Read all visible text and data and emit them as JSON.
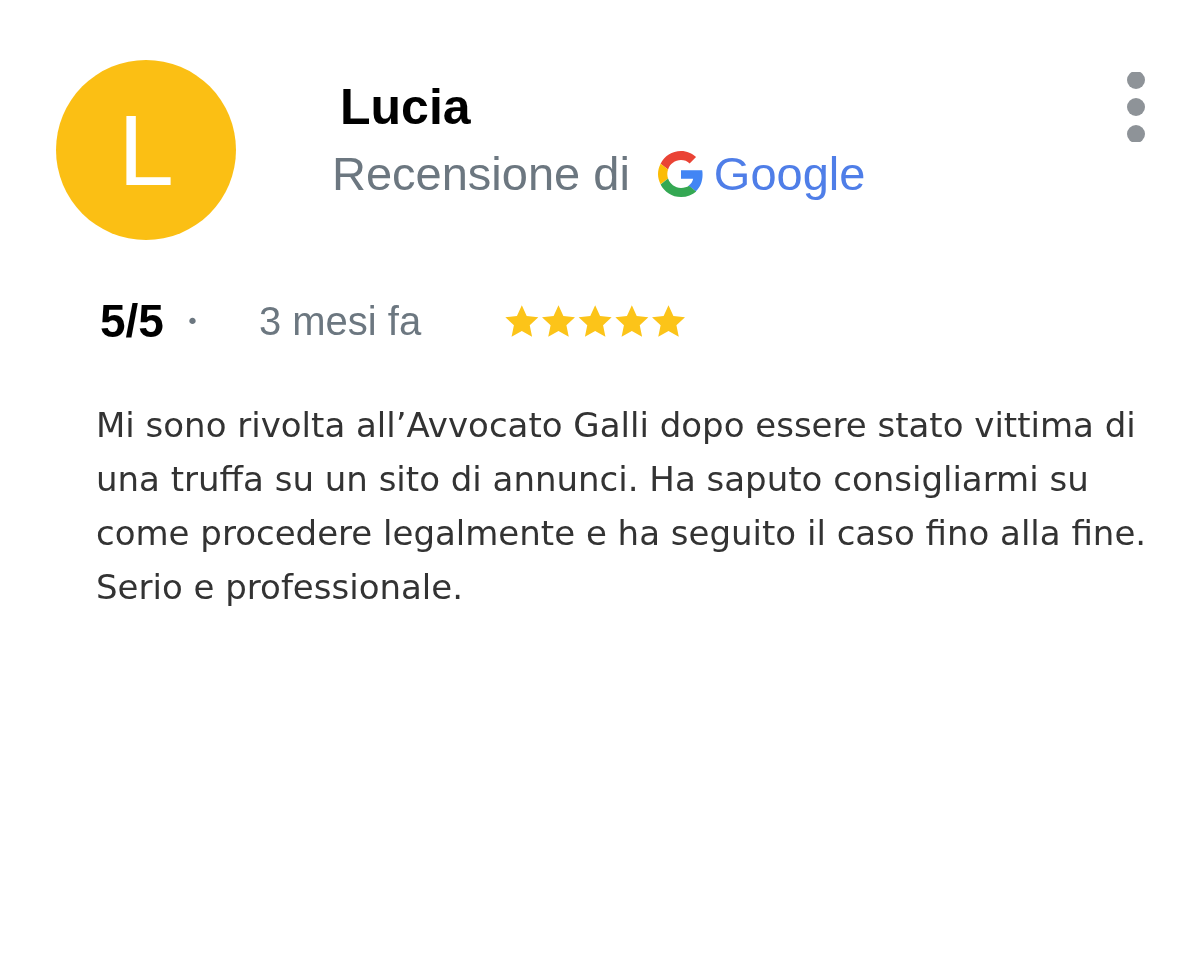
{
  "reviewer": {
    "initial": "L",
    "name": "Lucia"
  },
  "source": {
    "label": "Recensione di",
    "name": "Google"
  },
  "review": {
    "rating": "5/5",
    "separator": "•",
    "time": "3 mesi fa",
    "stars": 5,
    "text": "Mi sono rivolta all’Avvocato Galli dopo essere stato vittima di una truffa su un sito di annunci. Ha saputo consigliarmi su come procedere legalmente e ha seguito il caso fino alla fine. Serio e professionale."
  }
}
